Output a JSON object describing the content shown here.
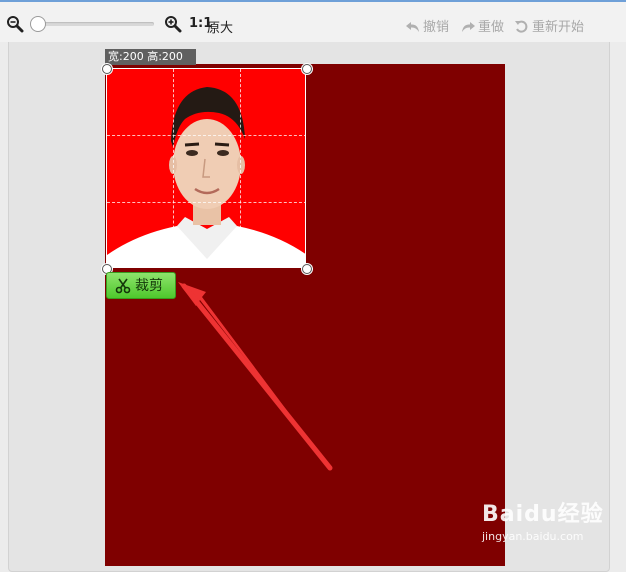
{
  "toolbar": {
    "zoom_ratio": "1:1",
    "zoom_label": "原大",
    "undo_label": "撤销",
    "redo_label": "重做",
    "restart_label": "重新开始",
    "zoom_level": 0
  },
  "crop": {
    "size_label": "宽:200 高:200",
    "button_label": "裁剪",
    "background_color": "#ff0000"
  },
  "canvas": {
    "background_color": "#7f0000"
  },
  "watermark": {
    "logo": "Baidu经验",
    "url": "jingyan.baidu.com"
  },
  "icons": [
    "zoom-out-icon",
    "zoom-in-icon",
    "undo-icon",
    "redo-icon",
    "restart-icon",
    "scissors-icon"
  ]
}
